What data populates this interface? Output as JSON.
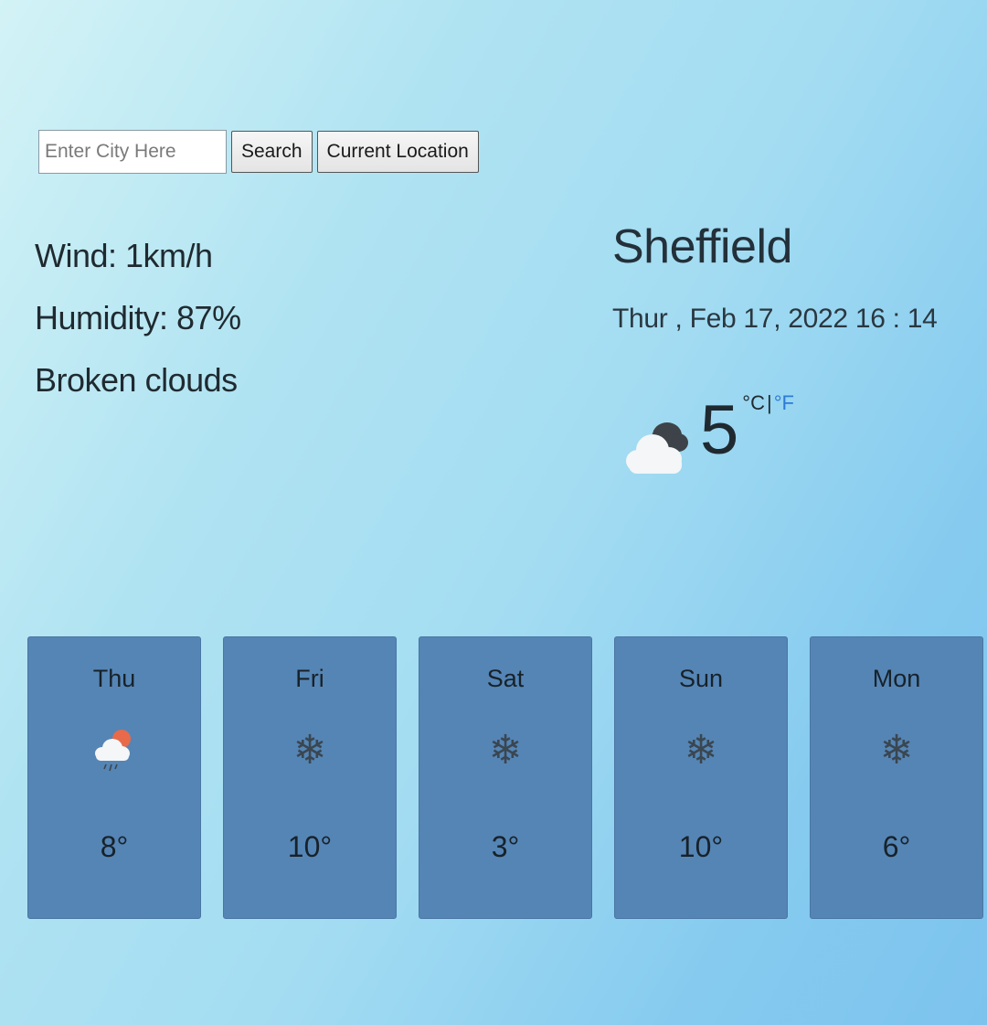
{
  "search": {
    "placeholder": "Enter City Here",
    "value": "",
    "search_label": "Search",
    "location_label": "Current Location"
  },
  "details": {
    "wind": "Wind: 1km/h",
    "humidity": "Humidity: 87%",
    "description": "Broken clouds"
  },
  "current": {
    "city": "Sheffield",
    "datetime": "Thur , Feb 17, 2022 16 : 14",
    "temperature": "5",
    "icon": "broken-clouds-icon",
    "unit_c": "°C",
    "unit_sep": "|",
    "unit_f": "°F"
  },
  "forecast": [
    {
      "day": "Thu",
      "icon": "rain-cloud-sun-icon",
      "temp": "8°"
    },
    {
      "day": "Fri",
      "icon": "snowflake-icon",
      "temp": "10°"
    },
    {
      "day": "Sat",
      "icon": "snowflake-icon",
      "temp": "3°"
    },
    {
      "day": "Sun",
      "icon": "snowflake-icon",
      "temp": "10°"
    },
    {
      "day": "Mon",
      "icon": "snowflake-icon",
      "temp": "6°"
    }
  ],
  "colors": {
    "card_bg": "#5585b5",
    "fahrenheit_link": "#2e7bd6"
  }
}
